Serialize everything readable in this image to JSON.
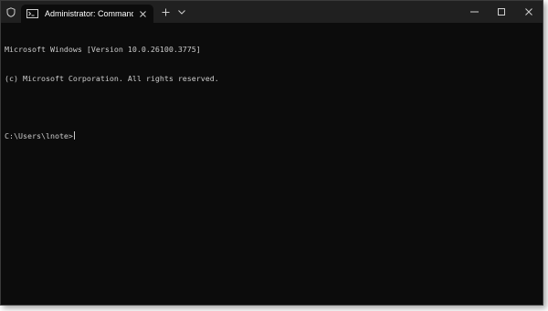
{
  "window": {
    "tab_title": "Administrator: Command Pro",
    "shield_icon": "shield-icon",
    "terminal_icon": "cmd-icon",
    "new_tab_icon": "plus-icon",
    "dropdown_icon": "chevron-down-icon",
    "minimize_icon": "minimize-icon",
    "maximize_icon": "maximize-icon",
    "close_icon": "close-icon"
  },
  "console": {
    "lines": [
      "Microsoft Windows [Version 10.0.26100.3775]",
      "(c) Microsoft Corporation. All rights reserved.",
      ""
    ],
    "prompt": "C:\\Users\\lnote>"
  },
  "colors": {
    "titlebar": "#202020",
    "console_bg": "#0c0c0c",
    "console_text": "#cccccc"
  }
}
